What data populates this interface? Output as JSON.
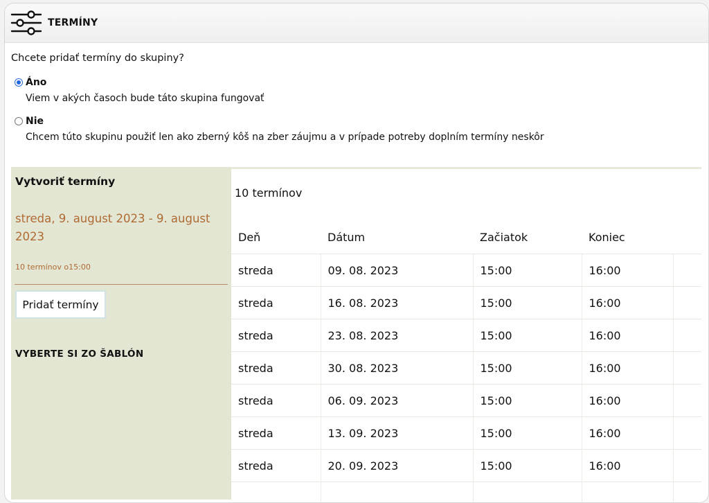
{
  "header": {
    "title": "TERMÍNY",
    "icon": "filter-sliders-icon"
  },
  "question": "Chcete pridať termíny do skupiny?",
  "options": [
    {
      "label": "Áno",
      "description": "Viem v akých časoch bude táto skupina fungovať",
      "checked": true
    },
    {
      "label": "Nie",
      "description": "Chcem túto skupinu použiť len ako zberný kôš na zber záujmu a v prípade potreby doplním termíny neskôr",
      "checked": false
    }
  ],
  "sidebar": {
    "title": "Vytvoriť termíny",
    "date_range": "streda, 9. august 2023 - 9. august 2023",
    "summary": "10 termínov o15:00",
    "add_button_label": "Pridať termíny",
    "templates_heading": "VYBERTE SI ZO ŠABLÓN"
  },
  "results": {
    "count_label": "10 termínov",
    "columns": [
      "Deň",
      "Dátum",
      "Začiatok",
      "Koniec"
    ],
    "rows": [
      {
        "day": "streda",
        "date": "09. 08. 2023",
        "start": "15:00",
        "end": "16:00"
      },
      {
        "day": "streda",
        "date": "16. 08. 2023",
        "start": "15:00",
        "end": "16:00"
      },
      {
        "day": "streda",
        "date": "23. 08. 2023",
        "start": "15:00",
        "end": "16:00"
      },
      {
        "day": "streda",
        "date": "30. 08. 2023",
        "start": "15:00",
        "end": "16:00"
      },
      {
        "day": "streda",
        "date": "06. 09. 2023",
        "start": "15:00",
        "end": "16:00"
      },
      {
        "day": "streda",
        "date": "13. 09. 2023",
        "start": "15:00",
        "end": "16:00"
      },
      {
        "day": "streda",
        "date": "20. 09. 2023",
        "start": "15:00",
        "end": "16:00"
      },
      {
        "day": "",
        "date": "",
        "start": "",
        "end": ""
      }
    ]
  },
  "colors": {
    "sidebar_bg": "#e2e6d3",
    "accent_orange": "#b06a34",
    "radio_checked": "#1f66e0"
  }
}
